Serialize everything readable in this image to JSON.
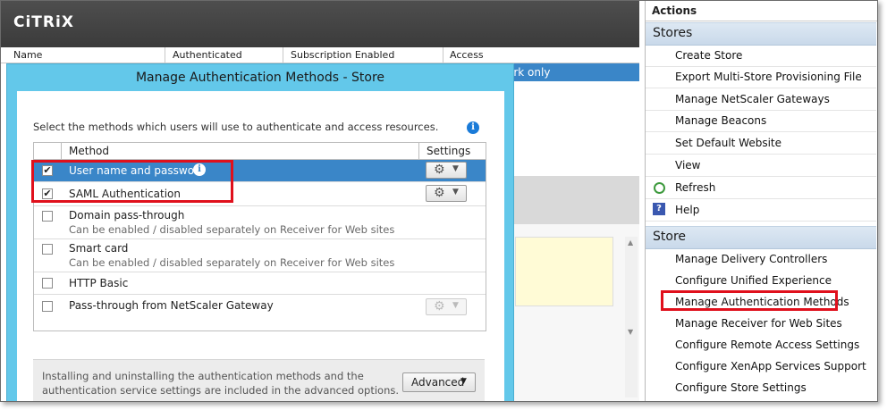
{
  "console": {
    "logo": "CiTRiX",
    "columns": [
      "Name",
      "Authenticated",
      "Subscription Enabled",
      "Access"
    ],
    "selected_row_text": "ork only"
  },
  "dialog": {
    "title": "Manage Authentication Methods - Store",
    "instruction": "Select the methods which users will use to authenticate and access resources.",
    "col_method": "Method",
    "col_settings": "Settings",
    "methods": [
      {
        "name": "User name and password",
        "sub": "",
        "checked": true
      },
      {
        "name": "SAML Authentication",
        "sub": "",
        "checked": true
      },
      {
        "name": "Domain pass-through",
        "sub": "Can be enabled / disabled separately on Receiver for Web sites",
        "checked": false
      },
      {
        "name": "Smart card",
        "sub": "Can be enabled / disabled separately on Receiver for Web sites",
        "checked": false
      },
      {
        "name": "HTTP Basic",
        "sub": "",
        "checked": false
      },
      {
        "name": "Pass-through from NetScaler Gateway",
        "sub": "",
        "checked": false
      }
    ],
    "footer_line1": "Installing and uninstalling the authentication methods and the",
    "footer_line2": "authentication service settings are included in the advanced options.",
    "advanced_label": "Advanced"
  },
  "actions": {
    "title": "Actions",
    "stores_header": "Stores",
    "stores_items": [
      "Create Store",
      "Export Multi-Store Provisioning File",
      "Manage NetScaler Gateways",
      "Manage Beacons",
      "Set Default Website",
      "View",
      "Refresh",
      "Help"
    ],
    "store_header": "Store",
    "store_items": [
      "Manage Delivery Controllers",
      "Configure Unified Experience",
      "Manage Authentication Methods",
      "Manage Receiver for Web Sites",
      "Configure Remote Access Settings",
      "Configure XenApp Services Support",
      "Configure Store Settings"
    ]
  },
  "colors": {
    "selection": "#3a86c8",
    "dialog_frame": "#63c8ea",
    "highlight": "#e0101c"
  }
}
